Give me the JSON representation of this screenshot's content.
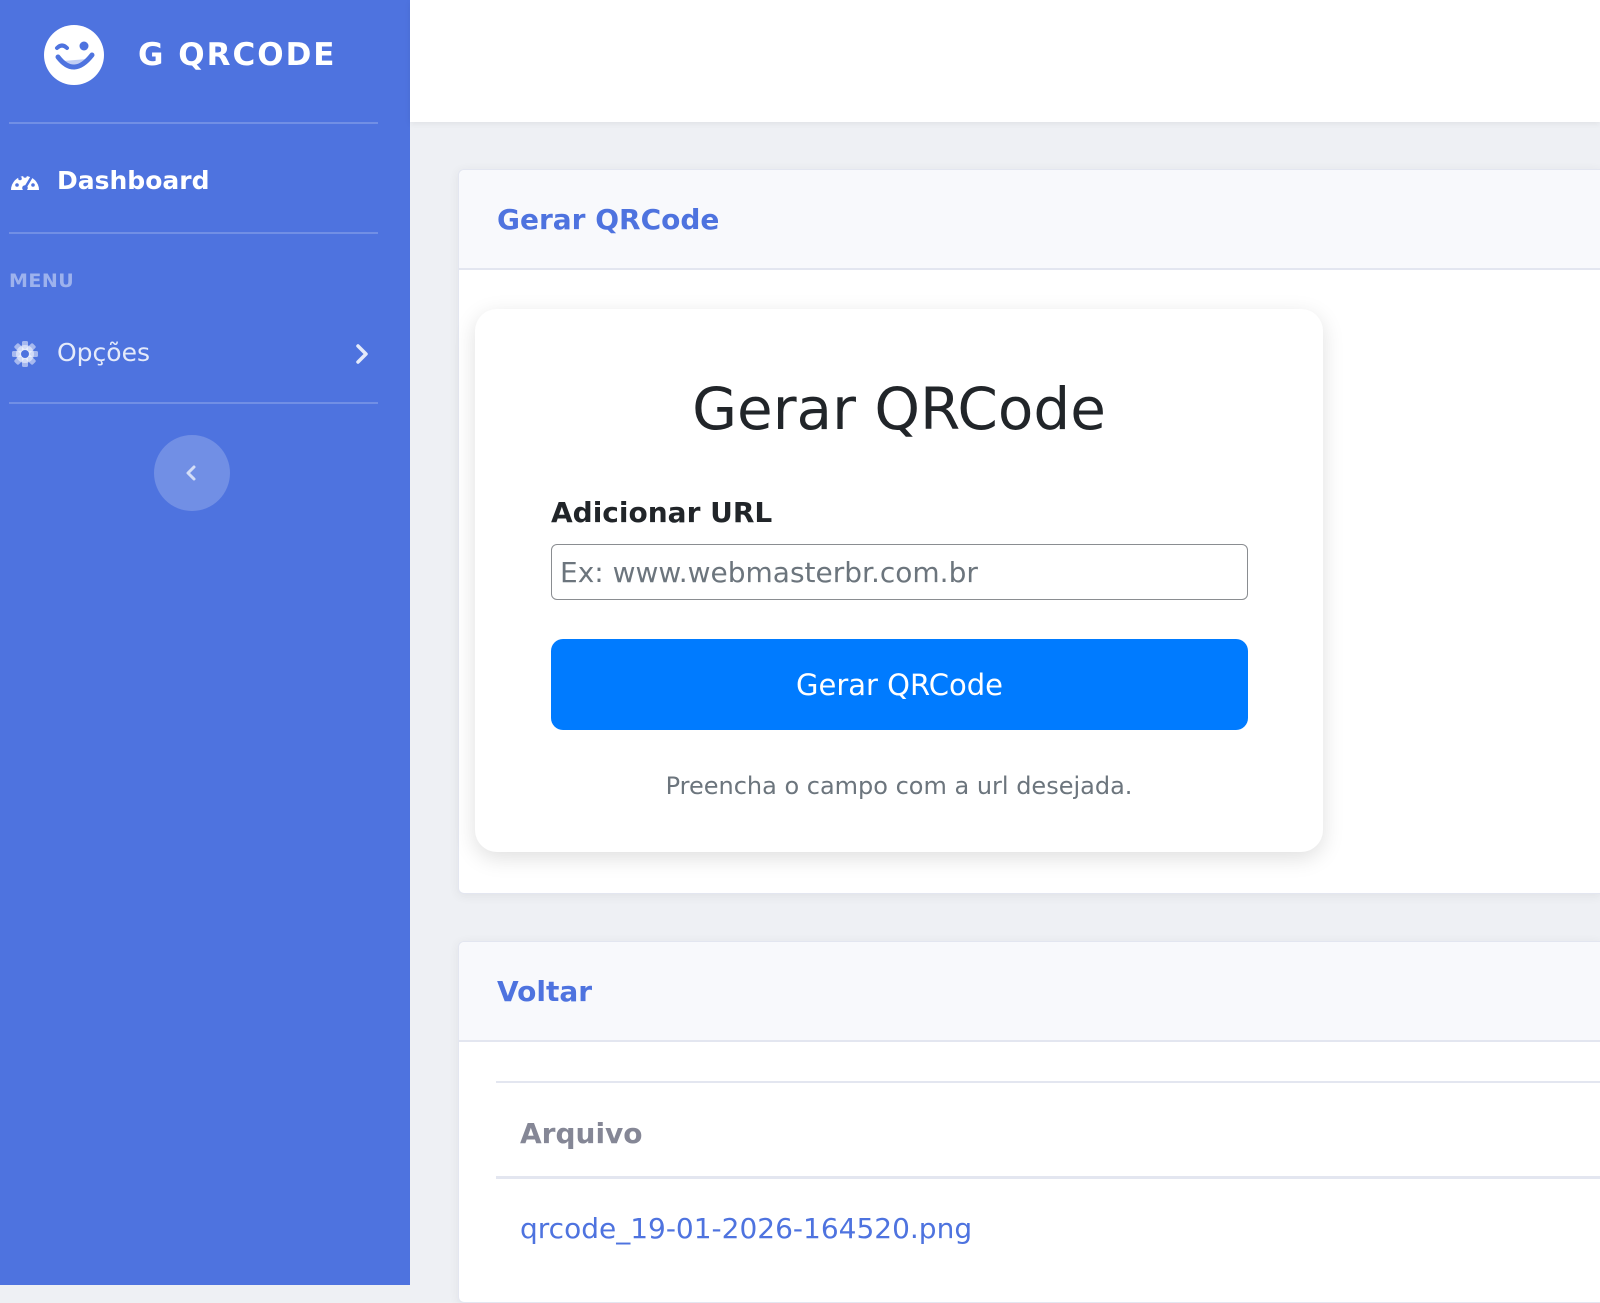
{
  "sidebar": {
    "brand": "G QRCODE",
    "brand_icon": "winking-face-icon",
    "dashboard_label": "Dashboard",
    "menu_heading": "MENU",
    "options_label": "Opções",
    "colors": {
      "background": "#4e73df"
    }
  },
  "form_card": {
    "header_title": "Gerar QRCode",
    "heading": "Gerar QRCode",
    "label": "Adicionar URL",
    "input": {
      "value": "",
      "placeholder": "Ex: www.webmasterbr.com.br"
    },
    "button_label": "Gerar QRCode",
    "help_text": "Preencha o campo com a url desejada.",
    "colors": {
      "button": "#007bff",
      "title": "#4e73df"
    }
  },
  "files_card": {
    "header_title": "Voltar",
    "table": {
      "columns": [
        "Arquivo"
      ],
      "rows": [
        [
          "qrcode_19-01-2026-164520.png"
        ]
      ]
    }
  }
}
